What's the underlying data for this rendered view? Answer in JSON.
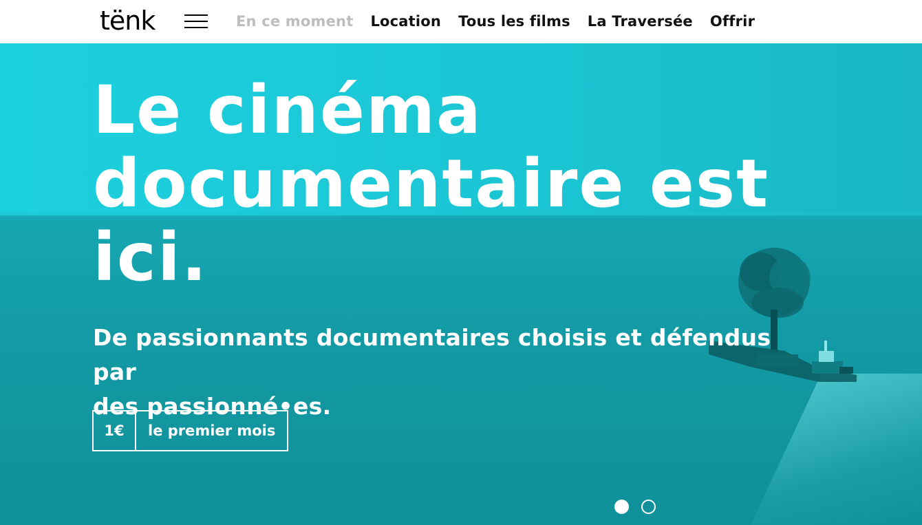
{
  "brand": {
    "logo_text": "tënk"
  },
  "nav": {
    "menu_icon": "hamburger-menu-icon",
    "items": [
      {
        "label": "En ce moment",
        "active": true
      },
      {
        "label": "Location"
      },
      {
        "label": "Tous les films"
      },
      {
        "label": "La Traversée"
      },
      {
        "label": "Offrir"
      }
    ]
  },
  "hero": {
    "title_line1": "Le cinéma",
    "title_line2": "documentaire est",
    "title_line3": "ici.",
    "subtitle_line1": "De passionnants documentaires choisis et défendus par",
    "subtitle_line2": "des passionné•es.",
    "cta": {
      "price": "1€",
      "label": "le premier mois"
    },
    "carousel": {
      "slide_count": 2,
      "active_index": 0
    }
  },
  "colors": {
    "accent": "#1ec9d8",
    "nav_muted": "#bdbdbd",
    "text_dark": "#111111",
    "white": "#ffffff"
  }
}
